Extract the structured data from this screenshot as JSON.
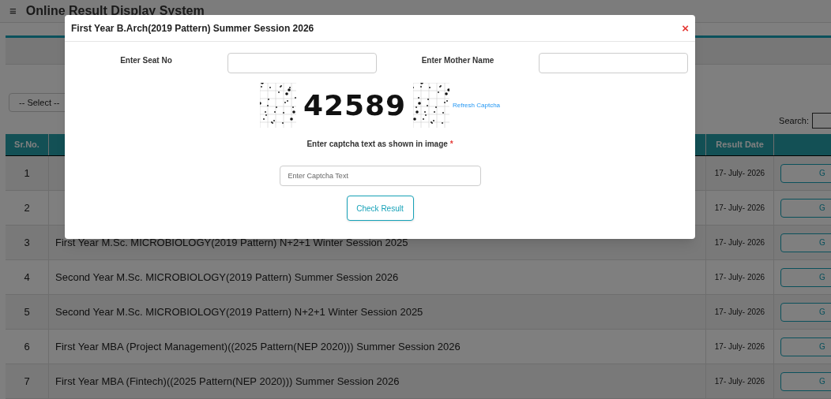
{
  "header": {
    "menu_icon": "≡",
    "title": "Online Result Display System"
  },
  "filter": {
    "select": "-- Select --",
    "search_label": "Search:"
  },
  "table": {
    "columns": [
      "Sr.No.",
      "Result Date"
    ],
    "rows": [
      {
        "sr": "1",
        "date": "17- July- 2026",
        "action": "G"
      },
      {
        "sr": "2",
        "date": "17- July- 2026",
        "action": "G"
      },
      {
        "sr": "3",
        "name": "First Year M.Sc. MICROBIOLOGY(2019 Pattern) N+2+1 Winter Session 2025",
        "date": "17- July- 2026",
        "action": "G"
      },
      {
        "sr": "4",
        "name": "Second Year M.Sc. MICROBIOLOGY(2019 Pattern) Summer Session 2026",
        "date": "17- July- 2026",
        "action": "G"
      },
      {
        "sr": "5",
        "name": "Second Year M.Sc. MICROBIOLOGY(2019 Pattern) N+2+1 Winter Session 2025",
        "date": "17- July- 2026",
        "action": "G"
      },
      {
        "sr": "6",
        "name": "First Year MBA (Project Management)((2025 Pattern(NEP 2020))) Summer Session 2026",
        "date": "17- July- 2026",
        "action": "G"
      },
      {
        "sr": "7",
        "name": "First Year MBA (Fintech)((2025 Pattern(NEP 2020))) Summer Session 2026",
        "date": "17- July- 2026",
        "action": "G"
      }
    ]
  },
  "modal": {
    "title": "First Year B.Arch(2019 Pattern) Summer Session 2026",
    "close": "×",
    "seat_label": "Enter Seat No",
    "mother_label": "Enter Mother Name",
    "captcha_text": "42589",
    "refresh": "Refresh Captcha",
    "captcha_label": "Enter captcha text as shown in image",
    "required_mark": "*",
    "captcha_placeholder": "Enter Captcha Text",
    "submit": "Check Result"
  }
}
